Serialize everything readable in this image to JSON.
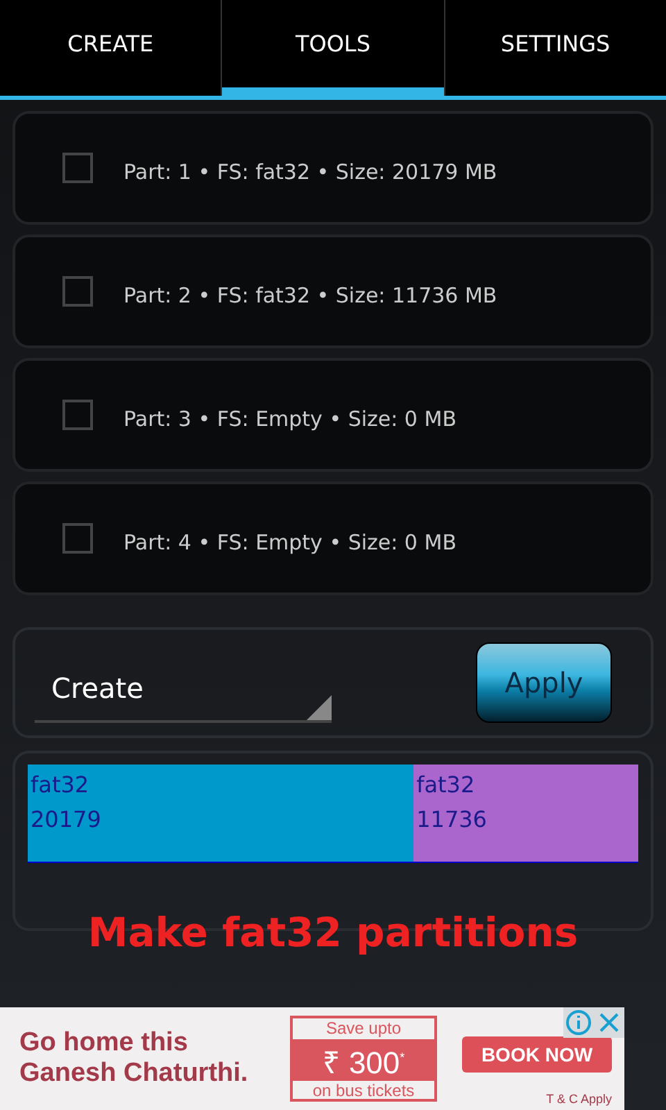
{
  "tabs": [
    {
      "label": "CREATE",
      "selected": false
    },
    {
      "label": "TOOLS",
      "selected": true
    },
    {
      "label": "SETTINGS",
      "selected": false
    }
  ],
  "partitions": [
    {
      "label": "Part: 1 • FS: fat32 • Size: 20179 MB",
      "checked": false
    },
    {
      "label": "Part: 2 • FS: fat32 • Size: 11736 MB",
      "checked": false
    },
    {
      "label": "Part: 3 • FS: Empty • Size: 0 MB",
      "checked": false
    },
    {
      "label": "Part: 4 • FS: Empty • Size: 0 MB",
      "checked": false
    }
  ],
  "action": {
    "dropdown_value": "Create",
    "button": "Apply"
  },
  "partition_bar": [
    {
      "fs": "fat32",
      "size": "20179",
      "level": 0.632,
      "color": "#0099cc"
    },
    {
      "fs": "fat32",
      "size": "11736",
      "level": 0.368,
      "color": "#aa66cc"
    }
  ],
  "message": "Make fat32 partitions",
  "ad": {
    "headline": "Go home this Ganesh Chaturthi.",
    "offer_top": "Save upto",
    "offer_amount": "₹ 300",
    "offer_mark": "*",
    "offer_bottom": "on bus tickets",
    "button": "BOOK NOW",
    "terms": "T & C Apply"
  }
}
